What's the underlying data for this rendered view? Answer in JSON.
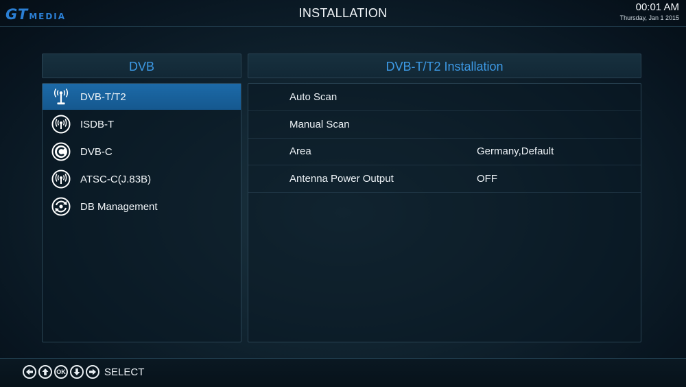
{
  "header": {
    "logo_gt": "GT",
    "logo_media": "MEDIA",
    "title": "INSTALLATION",
    "time": "00:01 AM",
    "date": "Thursday, Jan 1 2015"
  },
  "left_panel": {
    "title": "DVB",
    "items": [
      {
        "label": "DVB-T/T2",
        "icon": "antenna-tower-icon",
        "selected": true
      },
      {
        "label": "ISDB-T",
        "icon": "broadcast-icon",
        "selected": false
      },
      {
        "label": "DVB-C",
        "icon": "cable-c-icon",
        "selected": false
      },
      {
        "label": "ATSC-C(J.83B)",
        "icon": "broadcast-icon",
        "selected": false
      },
      {
        "label": "DB Management",
        "icon": "database-refresh-icon",
        "selected": false
      }
    ]
  },
  "right_panel": {
    "title": "DVB-T/T2 Installation",
    "rows": [
      {
        "label": "Auto Scan",
        "value": ""
      },
      {
        "label": "Manual Scan",
        "value": ""
      },
      {
        "label": "Area",
        "value": "Germany,Default"
      },
      {
        "label": "Antenna Power Output",
        "value": "OFF"
      }
    ]
  },
  "footer": {
    "keys": [
      "left-arrow-icon",
      "up-arrow-icon",
      "ok-icon",
      "down-arrow-icon",
      "right-arrow-icon"
    ],
    "ok_text": "OK",
    "select_label": "SELECT"
  },
  "colors": {
    "accent": "#3d9ae6",
    "selected_row": "#1b67a4",
    "background": "#10232f"
  }
}
